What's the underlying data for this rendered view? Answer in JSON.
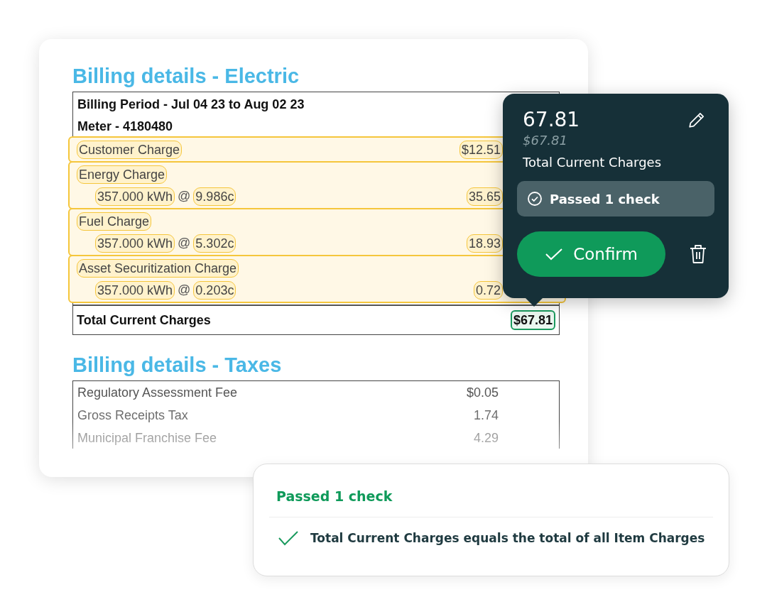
{
  "document": {
    "electric_title": "Billing details - Electric",
    "header_lines": [
      "Billing Period - Jul 04 23 to Aug 02 23",
      "Meter - 4180480"
    ],
    "charges": [
      {
        "label": "Customer Charge",
        "amount": "$12.51",
        "highlighted": true
      },
      {
        "label": "Energy Charge",
        "highlighted": true,
        "detail": {
          "quantity": "357.000 kWh",
          "at": "@",
          "rate": "9.986c",
          "amount": "35.65"
        }
      },
      {
        "label": "Fuel Charge",
        "highlighted": true,
        "detail": {
          "quantity": "357.000 kWh",
          "at": "@",
          "rate": "5.302c",
          "amount": "18.93"
        }
      },
      {
        "label": "Asset Securitization Charge",
        "highlighted": true,
        "detail": {
          "quantity": "357.000 kWh",
          "at": "@",
          "rate": "0.203c",
          "amount": "0.72"
        }
      }
    ],
    "total": {
      "label": "Total Current Charges",
      "amount": "$67.81",
      "selected": true
    },
    "taxes_title": "Billing details - Taxes",
    "taxes": [
      {
        "label": "Regulatory Assessment Fee",
        "amount": "$0.05"
      },
      {
        "label": "Gross Receipts Tax",
        "amount": "1.74"
      },
      {
        "label": "Municipal Franchise Fee",
        "amount": "4.29"
      }
    ]
  },
  "popover": {
    "value": "67.81",
    "original": "$67.81",
    "field": "Total Current Charges",
    "status": "Passed 1 check",
    "confirm": "Confirm"
  },
  "checks_card": {
    "title": "Passed 1 check",
    "checks": [
      {
        "text": "Total Current Charges equals the total of all Item Charges",
        "passed": true
      }
    ]
  }
}
